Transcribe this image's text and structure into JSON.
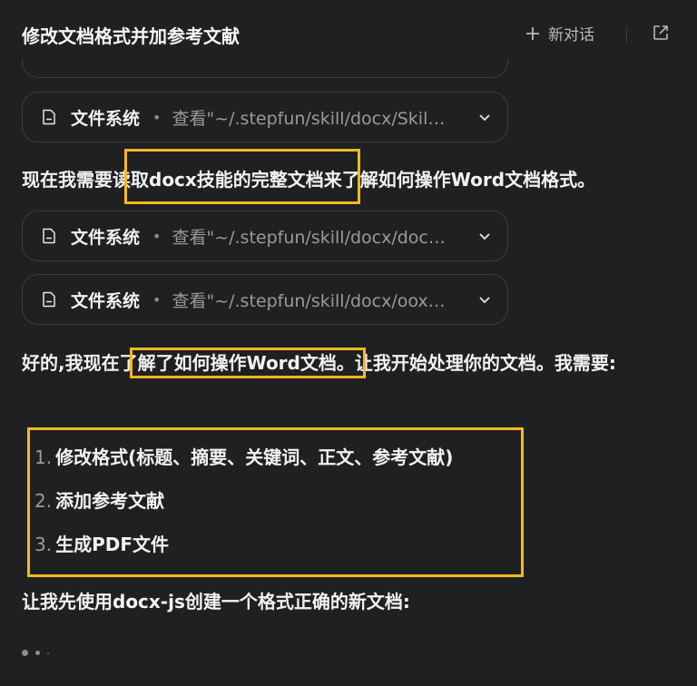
{
  "header": {
    "title": "修改文档格式并加参考文献",
    "new_chat_label": "新对话"
  },
  "cards": [
    {
      "label": "文件系统",
      "detail": "查看\"~/.stepfun/skill/docx/Skil…"
    },
    {
      "label": "文件系统",
      "detail": "查看\"~/.stepfun/skill/docx/doc…"
    },
    {
      "label": "文件系统",
      "detail": "查看\"~/.stepfun/skill/docx/oox…"
    }
  ],
  "messages": {
    "line1": "现在我需要读取docx技能的完整文档来了解如何操作Word文档格式。",
    "line2": "好的,我现在了解了如何操作Word文档。让我开始处理你的文档。我需要:",
    "list": [
      {
        "num": "1.",
        "text": "修改格式(标题、摘要、关键词、正文、参考文献)"
      },
      {
        "num": "2.",
        "text": "添加参考文献"
      },
      {
        "num": "3.",
        "text": "生成PDF文件"
      }
    ],
    "line3": "让我先使用docx-js创建一个格式正确的新文档:"
  },
  "colors": {
    "background": "#1f2022",
    "highlight": "#f5b820",
    "card_border": "#3a3b3e"
  }
}
